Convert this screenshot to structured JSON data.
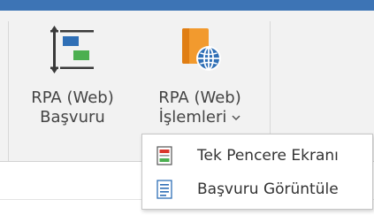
{
  "ribbon": {
    "buttons": [
      {
        "label_line1": "RPA (Web)",
        "label_line2": "Başvuru",
        "icon": "gantt-tasks-icon"
      },
      {
        "label_line1": "RPA (Web)",
        "label_line2": "İşlemleri",
        "icon": "web-document-globe-icon",
        "has_dropdown": true,
        "dropdown_icon": "chevron-down-icon"
      }
    ]
  },
  "dropdown": {
    "items": [
      {
        "label": "Tek Pencere Ekranı",
        "icon": "window-form-icon"
      },
      {
        "label": "Başvuru Görüntüle",
        "icon": "document-lines-icon"
      }
    ]
  },
  "colors": {
    "title_bar": "#3d74b5",
    "ribbon_background": "#f2f2f2",
    "icon_blue": "#2f6fb6",
    "icon_green": "#4caf50",
    "icon_orange": "#f29a2e",
    "icon_red": "#d9362b"
  }
}
